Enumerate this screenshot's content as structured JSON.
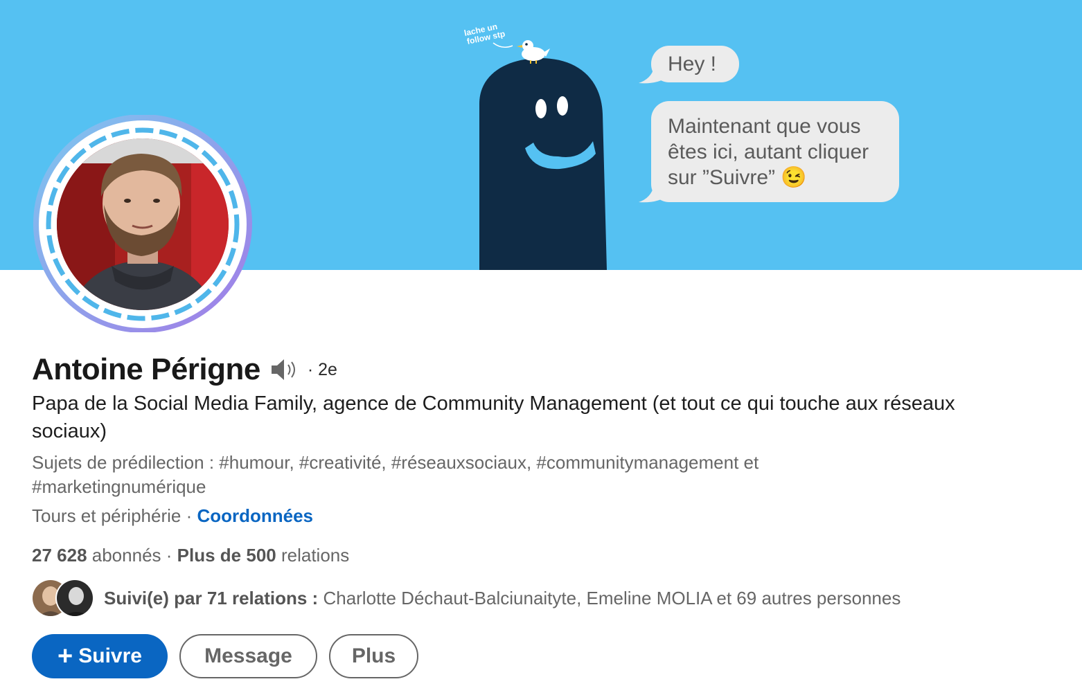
{
  "banner": {
    "bird_text_line1": "lache un",
    "bird_text_line2": "follow stp",
    "bubble_hey": "Hey !",
    "bubble_main_line1": "Maintenant que vous",
    "bubble_main_line2": "êtes ici, autant cliquer",
    "bubble_main_line3": "sur ”Suivre” 😉",
    "colors": {
      "sky": "#55c1f2",
      "character": "#0f2b45",
      "bubble": "#ececec"
    }
  },
  "profile": {
    "name": "Antoine Périgne",
    "pronunciation_icon": "speaker-icon",
    "degree": "· 2e",
    "headline": "Papa de la Social Media Family, agence de Community Management (et tout ce qui touche aux réseaux sociaux)",
    "topics": "Sujets de prédilection : #humour, #creativité, #réseauxsociaux, #communitymanagement et #marketingnumérique",
    "location": "Tours et périphérie",
    "location_separator": " · ",
    "contact_link": "Coordonnées",
    "followers_count": "27 628",
    "followers_label": "abonnés",
    "stats_separator": "  · ",
    "connections_count": "Plus de 500",
    "connections_label": "relations",
    "followed_by_bold": "Suivi(e) par 71 relations :",
    "followed_by_names": "Charlotte Déchaut-Balciunaityte, Emeline MOLIA et 69 autres personnes"
  },
  "actions": {
    "follow_label": "Suivre",
    "follow_icon": "+",
    "message_label": "Message",
    "more_label": "Plus"
  },
  "colors": {
    "primary": "#0a66c2",
    "avatar_ring_start": "#7cc8f0",
    "avatar_ring_end": "#a27be6",
    "avatar_dash": "#4fb6ea"
  }
}
